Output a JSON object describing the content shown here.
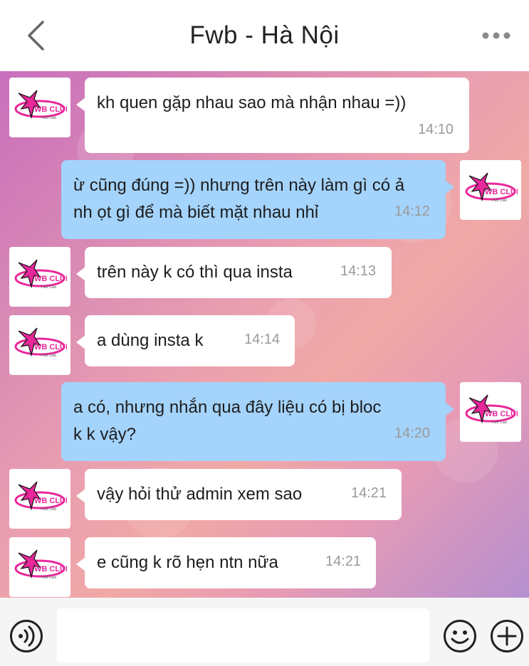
{
  "header": {
    "title": "Fwb - Hà Nội",
    "back_icon": "chevron-left-icon",
    "more_icon": "more-dots-icon"
  },
  "avatar": {
    "logo_text": "WB CLUP",
    "logo_sub": "Fwb Club",
    "brand_color": "#e8279a"
  },
  "messages": [
    {
      "side": "left",
      "text": "kh quen gặp nhau sao mà nhận nhau =))",
      "time": "14:10"
    },
    {
      "side": "right",
      "text": "ừ cũng đúng =)) nhưng trên này làm gì có ả\nnh ọt gì để mà biết mặt nhau nhỉ",
      "time": "14:12"
    },
    {
      "side": "left",
      "text": "trên này k có thì qua insta",
      "time": "14:13"
    },
    {
      "side": "left",
      "text": "a dùng insta k",
      "time": "14:14"
    },
    {
      "side": "right",
      "text": "a có, nhưng nhắn qua đây liệu có bị bloc\nk k vậy?",
      "time": "14:20"
    },
    {
      "side": "left",
      "text": "vậy hỏi thử admin xem sao",
      "time": "14:21"
    },
    {
      "side": "left",
      "text": "e cũng k rõ hẹn ntn nữa",
      "time": "14:21"
    }
  ],
  "input_bar": {
    "message_value": "",
    "voice_icon": "voice-icon",
    "emoji_icon": "emoji-icon",
    "add_icon": "plus-circle-icon"
  },
  "colors": {
    "outgoing_bubble": "#a4d3fb",
    "incoming_bubble": "#ffffff",
    "time_text": "#9a9a9a"
  }
}
